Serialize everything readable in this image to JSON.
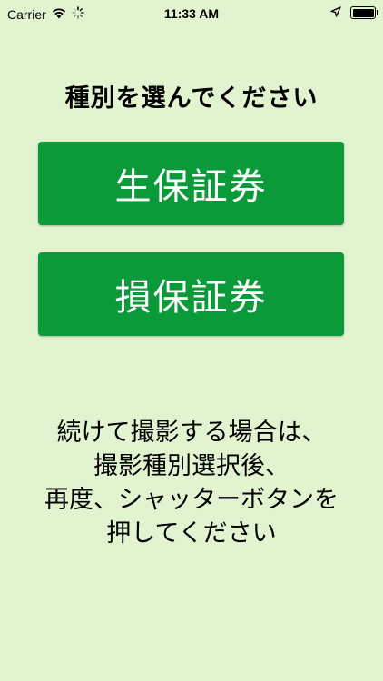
{
  "status_bar": {
    "carrier": "Carrier",
    "time": "11:33 AM",
    "icons": [
      "wifi-icon",
      "activity-spinner-icon",
      "location-arrow-icon",
      "battery-icon"
    ],
    "battery_level": 1.0
  },
  "main": {
    "prompt": "種別を選んでください",
    "buttons": [
      {
        "label": "生保証券"
      },
      {
        "label": "損保証券"
      }
    ],
    "instructions": [
      "続けて撮影する場合は、",
      "撮影種別選択後、",
      "再度、シャッターボタンを",
      "押してください"
    ]
  },
  "colors": {
    "background": "#e1f3cf",
    "button": "#0b9a3a",
    "button_text": "#ffffff"
  }
}
